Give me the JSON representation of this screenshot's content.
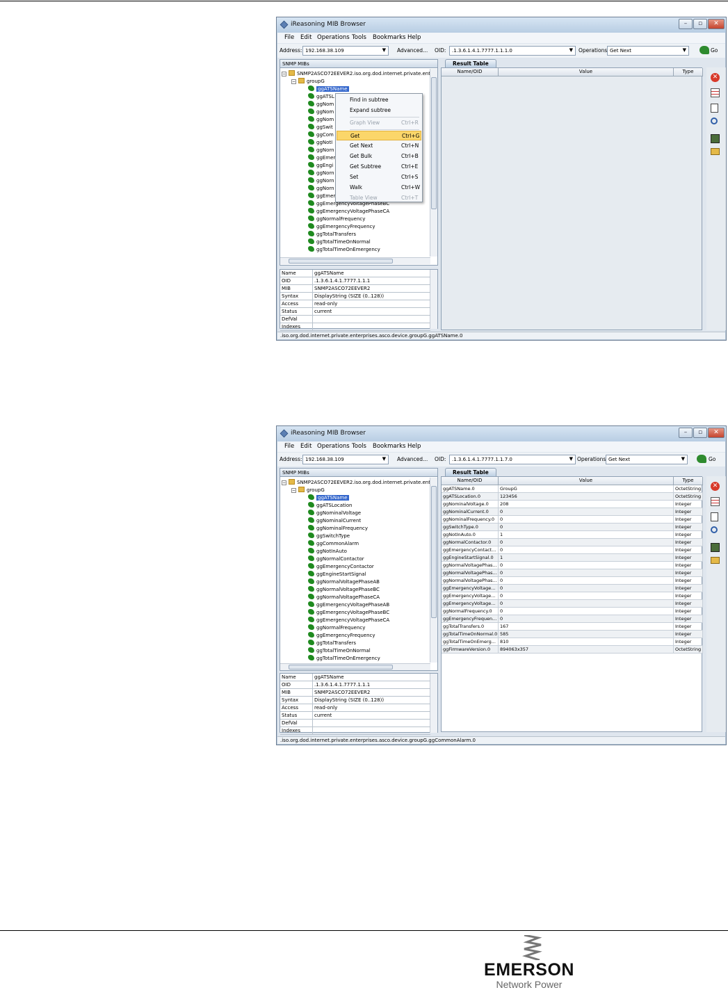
{
  "app": {
    "title": "iReasoning MIB Browser",
    "menu": [
      "File",
      "Edit",
      "Operations",
      "Tools",
      "Bookmarks",
      "Help"
    ],
    "address_label": "Address:",
    "address_value": "192.168.38.109",
    "advanced_label": "Advanced...",
    "oid_label": "OID:",
    "operations_label": "Operations:",
    "operation_value": "Get Next",
    "go_label": "Go",
    "mib_panel_title": "SNMP MIBs",
    "result_tab": "Result Table",
    "columns": [
      "Name/OID",
      "Value",
      "Type"
    ],
    "tree_root": "SNMP2ASCO72EEVER2.iso.org.dod.internet.private.ente",
    "tree_group": "groupG"
  },
  "shot1": {
    "oid_value": ".1.3.6.1.4.1.7777.1.1.1.0",
    "tree_items": [
      "ggATSName",
      "ggATSL",
      "ggNom",
      "ggNom",
      "ggNom",
      "ggSwit",
      "ggCom",
      "ggNotI",
      "ggNorn",
      "ggEmer",
      "ggEngi",
      "ggNorn",
      "ggNorn",
      "ggNorn",
      "ggEmer",
      "ggEmergencyVoltagePhaseBC",
      "ggEmergencyVoltagePhaseCA",
      "ggNormalFrequency",
      "ggEmergencyFrequency",
      "ggTotalTransfers",
      "ggTotalTimeOnNormal",
      "ggTotalTimeOnEmergency"
    ],
    "context_menu": [
      {
        "label": "Find in subtree",
        "shortcut": "",
        "disabled": false
      },
      {
        "label": "Expand subtree",
        "shortcut": "",
        "disabled": false
      },
      {
        "label": "Graph View",
        "shortcut": "Ctrl+R",
        "disabled": true
      },
      {
        "label": "Get",
        "shortcut": "Ctrl+G",
        "disabled": false,
        "highlight": true
      },
      {
        "label": "Get Next",
        "shortcut": "Ctrl+N",
        "disabled": false
      },
      {
        "label": "Get Bulk",
        "shortcut": "Ctrl+B",
        "disabled": false
      },
      {
        "label": "Get Subtree",
        "shortcut": "Ctrl+E",
        "disabled": false
      },
      {
        "label": "Set",
        "shortcut": "Ctrl+S",
        "disabled": false
      },
      {
        "label": "Walk",
        "shortcut": "Ctrl+W",
        "disabled": false
      },
      {
        "label": "Table View",
        "shortcut": "Ctrl+T",
        "disabled": true
      }
    ],
    "properties": [
      [
        "Name",
        "ggATSName"
      ],
      [
        "OID",
        ".1.3.6.1.4.1.7777.1.1.1"
      ],
      [
        "MIB",
        "SNMP2ASCO72EEVER2"
      ],
      [
        "Syntax",
        "DisplayString (SIZE (0..128))"
      ],
      [
        "Access",
        "read-only"
      ],
      [
        "Status",
        "current"
      ],
      [
        "DefVal",
        ""
      ],
      [
        "Indexes",
        ""
      ]
    ],
    "status": ".iso.org.dod.internet.private.enterprises.asco.device.groupG.ggATSName.0"
  },
  "shot2": {
    "oid_value": ".1.3.6.1.4.1.7777.1.1.7.0",
    "tree_items": [
      "ggATSName",
      "ggATSLocation",
      "ggNominalVoltage",
      "ggNominalCurrent",
      "ggNominalFrequency",
      "ggSwitchType",
      "ggCommonAlarm",
      "ggNotInAuto",
      "ggNormalContactor",
      "ggEmergencyContactor",
      "ggEngineStartSignal",
      "ggNormalVoltagePhaseAB",
      "ggNormalVoltagePhaseBC",
      "ggNormalVoltagePhaseCA",
      "ggEmergencyVoltagePhaseAB",
      "ggEmergencyVoltagePhaseBC",
      "ggEmergencyVoltagePhaseCA",
      "ggNormalFrequency",
      "ggEmergencyFrequency",
      "ggTotalTransfers",
      "ggTotalTimeOnNormal",
      "ggTotalTimeOnEmergency"
    ],
    "results": [
      [
        "ggATSName.0",
        "GroupG",
        "OctetString"
      ],
      [
        "ggATSLocation.0",
        "123456",
        "OctetString"
      ],
      [
        "ggNominalVoltage.0",
        "208",
        "Integer"
      ],
      [
        "ggNominalCurrent.0",
        "0",
        "Integer"
      ],
      [
        "ggNominalFrequency.0",
        "0",
        "Integer"
      ],
      [
        "ggSwitchType.0",
        "0",
        "Integer"
      ],
      [
        "ggNotInAuto.0",
        "1",
        "Integer"
      ],
      [
        "ggNormalContactor.0",
        "0",
        "Integer"
      ],
      [
        "ggEmergencyContact...",
        "0",
        "Integer"
      ],
      [
        "ggEngineStartSignal.0",
        "1",
        "Integer"
      ],
      [
        "ggNormalVoltagePhas...",
        "0",
        "Integer"
      ],
      [
        "ggNormalVoltagePhas...",
        "0",
        "Integer"
      ],
      [
        "ggNormalVoltagePhas...",
        "0",
        "Integer"
      ],
      [
        "ggEmergencyVoltage...",
        "0",
        "Integer"
      ],
      [
        "ggEmergencyVoltage...",
        "0",
        "Integer"
      ],
      [
        "ggEmergencyVoltage...",
        "0",
        "Integer"
      ],
      [
        "ggNormalFrequency.0",
        "0",
        "Integer"
      ],
      [
        "ggEmergencyFrequen...",
        "0",
        "Integer"
      ],
      [
        "ggTotalTransfers.0",
        "167",
        "Integer"
      ],
      [
        "ggTotalTimeOnNormal.0",
        "585",
        "Integer"
      ],
      [
        "ggTotalTimeOnEmerg...",
        "810",
        "Integer"
      ],
      [
        "ggFirmwareVersion.0",
        "894063x357",
        "OctetString"
      ]
    ],
    "properties": [
      [
        "Name",
        "ggATSName"
      ],
      [
        "OID",
        ".1.3.6.1.4.1.7777.1.1.1"
      ],
      [
        "MIB",
        "SNMP2ASCO72EEVER2"
      ],
      [
        "Syntax",
        "DisplayString (SIZE (0..128))"
      ],
      [
        "Access",
        "read-only"
      ],
      [
        "Status",
        "current"
      ],
      [
        "DefVal",
        ""
      ],
      [
        "Indexes",
        ""
      ]
    ],
    "status": ".iso.org.dod.internet.private.enterprises.asco.device.groupG.ggCommonAlarm.0"
  },
  "footer": {
    "brand": "EMERSON",
    "tagline": "Network Power"
  },
  "colors": {
    "selection": "#3366cc",
    "leaf": "#1f8a1f",
    "menu_highlight": "#fbd66a"
  }
}
